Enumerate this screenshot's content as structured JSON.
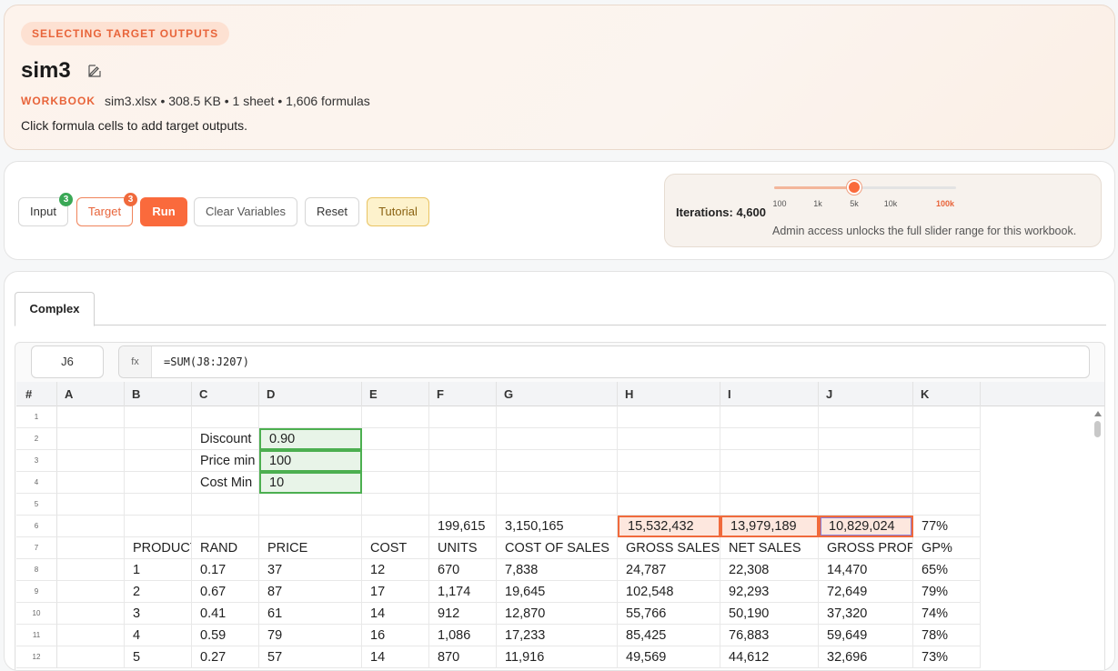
{
  "header": {
    "status": "SELECTING TARGET OUTPUTS",
    "title": "sim3",
    "meta_label": "WORKBOOK",
    "meta_text": "sim3.xlsx • 308.5 KB • 1 sheet • 1,606 formulas",
    "hint": "Click formula cells to add target outputs."
  },
  "toolbar": {
    "input_label": "Input",
    "input_badge": "3",
    "target_label": "Target",
    "target_badge": "3",
    "run_label": "Run",
    "clear_label": "Clear Variables",
    "reset_label": "Reset",
    "tutorial_label": "Tutorial",
    "iterations_label": "Iterations: 4,600",
    "slider_ticks": [
      "100",
      "1k",
      "5k",
      "10k",
      "100k"
    ],
    "slider_position": 0.44,
    "slider_tick_positions": [
      0.03,
      0.24,
      0.44,
      0.64,
      0.94
    ],
    "admin_note": "Admin access unlocks the full slider range for this workbook."
  },
  "tabs": [
    "Complex"
  ],
  "formula_bar": {
    "cell_ref": "J6",
    "fx": "fx",
    "formula": "=SUM(J8:J207)"
  },
  "grid": {
    "columns": [
      "#",
      "A",
      "B",
      "C",
      "D",
      "E",
      "F",
      "G",
      "H",
      "I",
      "J",
      "K"
    ],
    "rows": [
      {
        "num": "1",
        "cells": [
          "",
          "",
          "",
          "",
          "",
          "",
          "",
          "",
          "",
          "",
          ""
        ]
      },
      {
        "num": "2",
        "cells": [
          "",
          "",
          "Discount",
          "0.90",
          "",
          "",
          "",
          "",
          "",
          "",
          ""
        ]
      },
      {
        "num": "3",
        "cells": [
          "",
          "",
          "Price min",
          "100",
          "",
          "",
          "",
          "",
          "",
          "",
          ""
        ]
      },
      {
        "num": "4",
        "cells": [
          "",
          "",
          "Cost Min",
          "10",
          "",
          "",
          "",
          "",
          "",
          "",
          ""
        ]
      },
      {
        "num": "5",
        "cells": [
          "",
          "",
          "",
          "",
          "",
          "",
          "",
          "",
          "",
          "",
          ""
        ]
      },
      {
        "num": "6",
        "cells": [
          "",
          "",
          "",
          "",
          "",
          "199,615",
          "3,150,165",
          "15,532,432",
          "13,979,189",
          "10,829,024",
          "77%"
        ]
      },
      {
        "num": "7",
        "cells": [
          "",
          "PRODUCT",
          "RAND",
          "PRICE",
          "COST",
          "UNITS",
          "COST OF SALES",
          "GROSS SALES",
          "NET SALES",
          "GROSS PROFIT",
          "GP%"
        ]
      },
      {
        "num": "8",
        "cells": [
          "",
          "1",
          "0.17",
          "37",
          "12",
          "670",
          "7,838",
          "24,787",
          "22,308",
          "14,470",
          "65%"
        ]
      },
      {
        "num": "9",
        "cells": [
          "",
          "2",
          "0.67",
          "87",
          "17",
          "1,174",
          "19,645",
          "102,548",
          "92,293",
          "72,649",
          "79%"
        ]
      },
      {
        "num": "10",
        "cells": [
          "",
          "3",
          "0.41",
          "61",
          "14",
          "912",
          "12,870",
          "55,766",
          "50,190",
          "37,320",
          "74%"
        ]
      },
      {
        "num": "11",
        "cells": [
          "",
          "4",
          "0.59",
          "79",
          "16",
          "1,086",
          "17,233",
          "85,425",
          "76,883",
          "59,649",
          "78%"
        ]
      },
      {
        "num": "12",
        "cells": [
          "",
          "5",
          "0.27",
          "57",
          "14",
          "870",
          "11,916",
          "49,569",
          "44,612",
          "32,696",
          "73%"
        ]
      }
    ]
  },
  "colors": {
    "accent": "#fa6a3c",
    "input_green": "#4caf50",
    "target_orange": "#f06a3c"
  }
}
